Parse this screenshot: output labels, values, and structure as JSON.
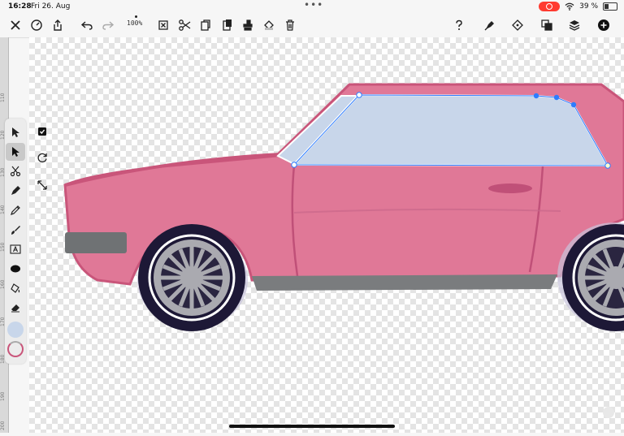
{
  "status": {
    "time": "16:28",
    "date": "Fri 26. Aug",
    "battery": "39 %"
  },
  "toolbar": {
    "zoom": "100%"
  },
  "ruler": {
    "ticks": [
      "110",
      "120",
      "130",
      "140",
      "150",
      "160",
      "170",
      "180",
      "190",
      "200"
    ]
  },
  "colors": {
    "fill": "#c8d6ea",
    "stroke": "#ffffff",
    "accent": "#2d7cff",
    "car_body": "#e07897",
    "tire": "#1d1836"
  },
  "tools": [
    "select-arrow-icon",
    "direct-select-icon",
    "scissors-icon",
    "pen-icon",
    "pencil-icon",
    "brush-icon",
    "text-icon",
    "shape-icon",
    "fill-bucket-icon",
    "eraser-icon"
  ],
  "subtools": [
    "checkbox-icon",
    "rotate-icon",
    "resize-icon"
  ]
}
